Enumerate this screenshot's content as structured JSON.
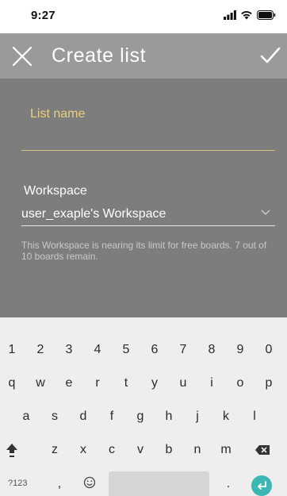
{
  "status_bar": {
    "time": "9:27"
  },
  "app_bar": {
    "title": "Create list",
    "close_icon": "close-icon",
    "confirm_icon": "checkmark-icon"
  },
  "form": {
    "list_name_label": "List name",
    "list_name_value": "",
    "workspace_label": "Workspace",
    "workspace_value": "user_exaple's Workspace",
    "workspace_note": "This Workspace is nearing its limit for free boards. 7 out of 10 boards remain."
  },
  "keyboard": {
    "row1": [
      "1",
      "2",
      "3",
      "4",
      "5",
      "6",
      "7",
      "8",
      "9",
      "0"
    ],
    "row2": [
      "q",
      "w",
      "e",
      "r",
      "t",
      "y",
      "u",
      "i",
      "o",
      "p"
    ],
    "row3": [
      "a",
      "s",
      "d",
      "f",
      "g",
      "h",
      "j",
      "k",
      "l"
    ],
    "row4": [
      "z",
      "x",
      "c",
      "v",
      "b",
      "n",
      "m"
    ],
    "symbols_label": "?123",
    "comma": ",",
    "period": ".",
    "shift_icon": "shift-arrow-icon",
    "backspace_icon": "backspace-icon",
    "emoji_icon": "emoji-icon",
    "enter_icon": "enter-arrow-icon"
  },
  "colors": {
    "app_bar": "#9a9a9a",
    "form_bg": "#7d7d7d",
    "accent_label": "#e8cf7e",
    "keyboard_bg": "#eeeeee",
    "enter_key": "#3cb7b3"
  }
}
